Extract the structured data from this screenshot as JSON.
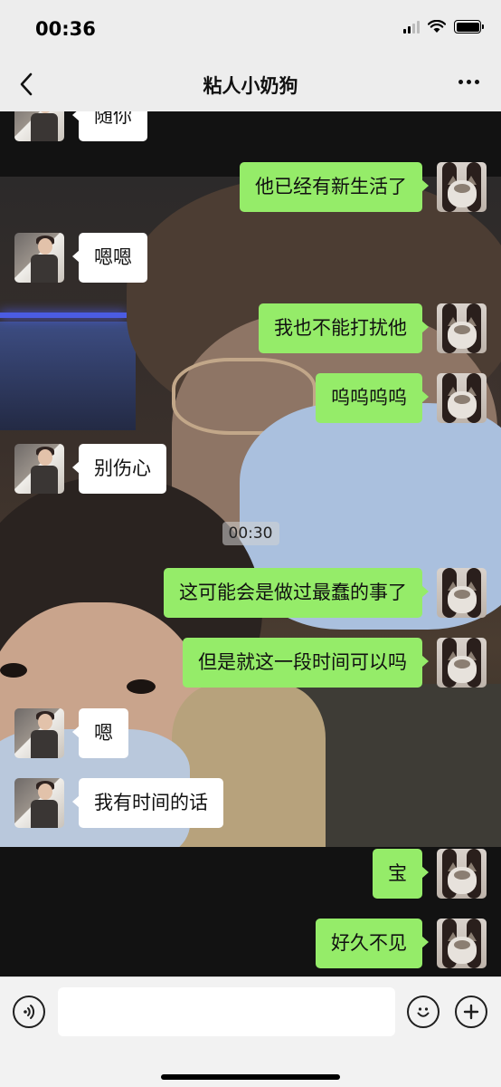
{
  "status_bar": {
    "time": "00:36"
  },
  "nav": {
    "title": "粘人小奶狗"
  },
  "chat": {
    "messages": [
      {
        "side": "left",
        "text": "随你"
      },
      {
        "side": "right",
        "text": "他已经有新生活了"
      },
      {
        "side": "left",
        "text": "嗯嗯"
      },
      {
        "side": "right",
        "text": "我也不能打扰他"
      },
      {
        "side": "right",
        "text": "呜呜呜呜"
      },
      {
        "side": "left",
        "text": "别伤心"
      },
      {
        "side": "right",
        "text": "这可能会是做过最蠢的事了"
      },
      {
        "side": "right",
        "text": "但是就这一段时间可以吗"
      },
      {
        "side": "left",
        "text": "嗯"
      },
      {
        "side": "left",
        "text": "我有时间的话"
      },
      {
        "side": "right",
        "text": "宝"
      },
      {
        "side": "right",
        "text": "好久不见"
      }
    ],
    "timestamp": "00:30"
  },
  "input_bar": {
    "placeholder": ""
  },
  "icons": {
    "back": "chevron-left-icon",
    "more": "ellipsis-icon",
    "voice": "voice-icon",
    "emoji": "emoji-icon",
    "plus": "plus-icon"
  },
  "colors": {
    "outgoing_bubble": "#95ec69",
    "incoming_bubble": "#ffffff",
    "nav_bg": "#ededed"
  }
}
